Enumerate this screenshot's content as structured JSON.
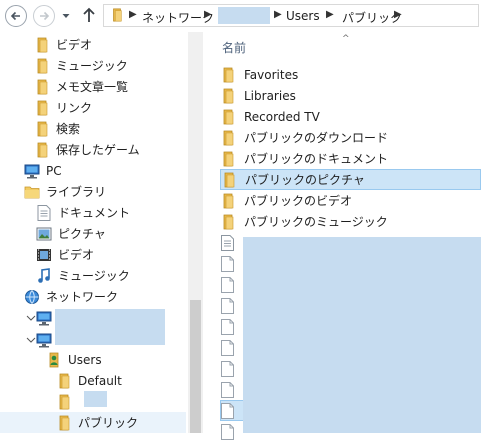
{
  "address": {
    "crumbs": [
      {
        "label": "ネットワーク"
      },
      {
        "label": ""
      },
      {
        "label": "Users"
      },
      {
        "label": "パブリック"
      }
    ]
  },
  "nav": {
    "items": [
      {
        "label": "ビデオ",
        "icon": "video-folder-icon"
      },
      {
        "label": "ミュージック",
        "icon": "music-folder-icon"
      },
      {
        "label": "メモ文章一覧",
        "icon": "folder-icon"
      },
      {
        "label": "リンク",
        "icon": "links-folder-icon"
      },
      {
        "label": "検索",
        "icon": "search-folder-icon"
      },
      {
        "label": "保存したゲーム",
        "icon": "saved-games-folder-icon"
      },
      {
        "label": "PC",
        "icon": "pc-icon"
      },
      {
        "label": "ライブラリ",
        "icon": "libraries-icon"
      },
      {
        "label": "ドキュメント",
        "icon": "documents-library-icon"
      },
      {
        "label": "ピクチャ",
        "icon": "pictures-library-icon"
      },
      {
        "label": "ビデオ",
        "icon": "videos-library-icon"
      },
      {
        "label": "ミュージック",
        "icon": "music-library-icon"
      },
      {
        "label": "ネットワーク",
        "icon": "network-icon"
      },
      {
        "label": "",
        "icon": "computer-icon"
      },
      {
        "label": "",
        "icon": "computer-icon"
      },
      {
        "label": "Users",
        "icon": "user-folder-icon"
      },
      {
        "label": "Default",
        "icon": "folder-icon"
      },
      {
        "label": "",
        "icon": "folder-icon"
      },
      {
        "label": "パブリック",
        "icon": "folder-icon"
      }
    ]
  },
  "content": {
    "column_header": "名前",
    "items": [
      {
        "label": "Favorites"
      },
      {
        "label": "Libraries"
      },
      {
        "label": "Recorded TV"
      },
      {
        "label": "パブリックのダウンロード"
      },
      {
        "label": "パブリックのドキュメント"
      },
      {
        "label": "パブリックのピクチャ",
        "selected": true
      },
      {
        "label": "パブリックのビデオ"
      },
      {
        "label": "パブリックのミュージック"
      }
    ]
  },
  "colors": {
    "selection": "#cce4f7",
    "selection_border": "#99c9ef",
    "redaction": "#c6dcf0",
    "folder": "#e8b94a"
  }
}
